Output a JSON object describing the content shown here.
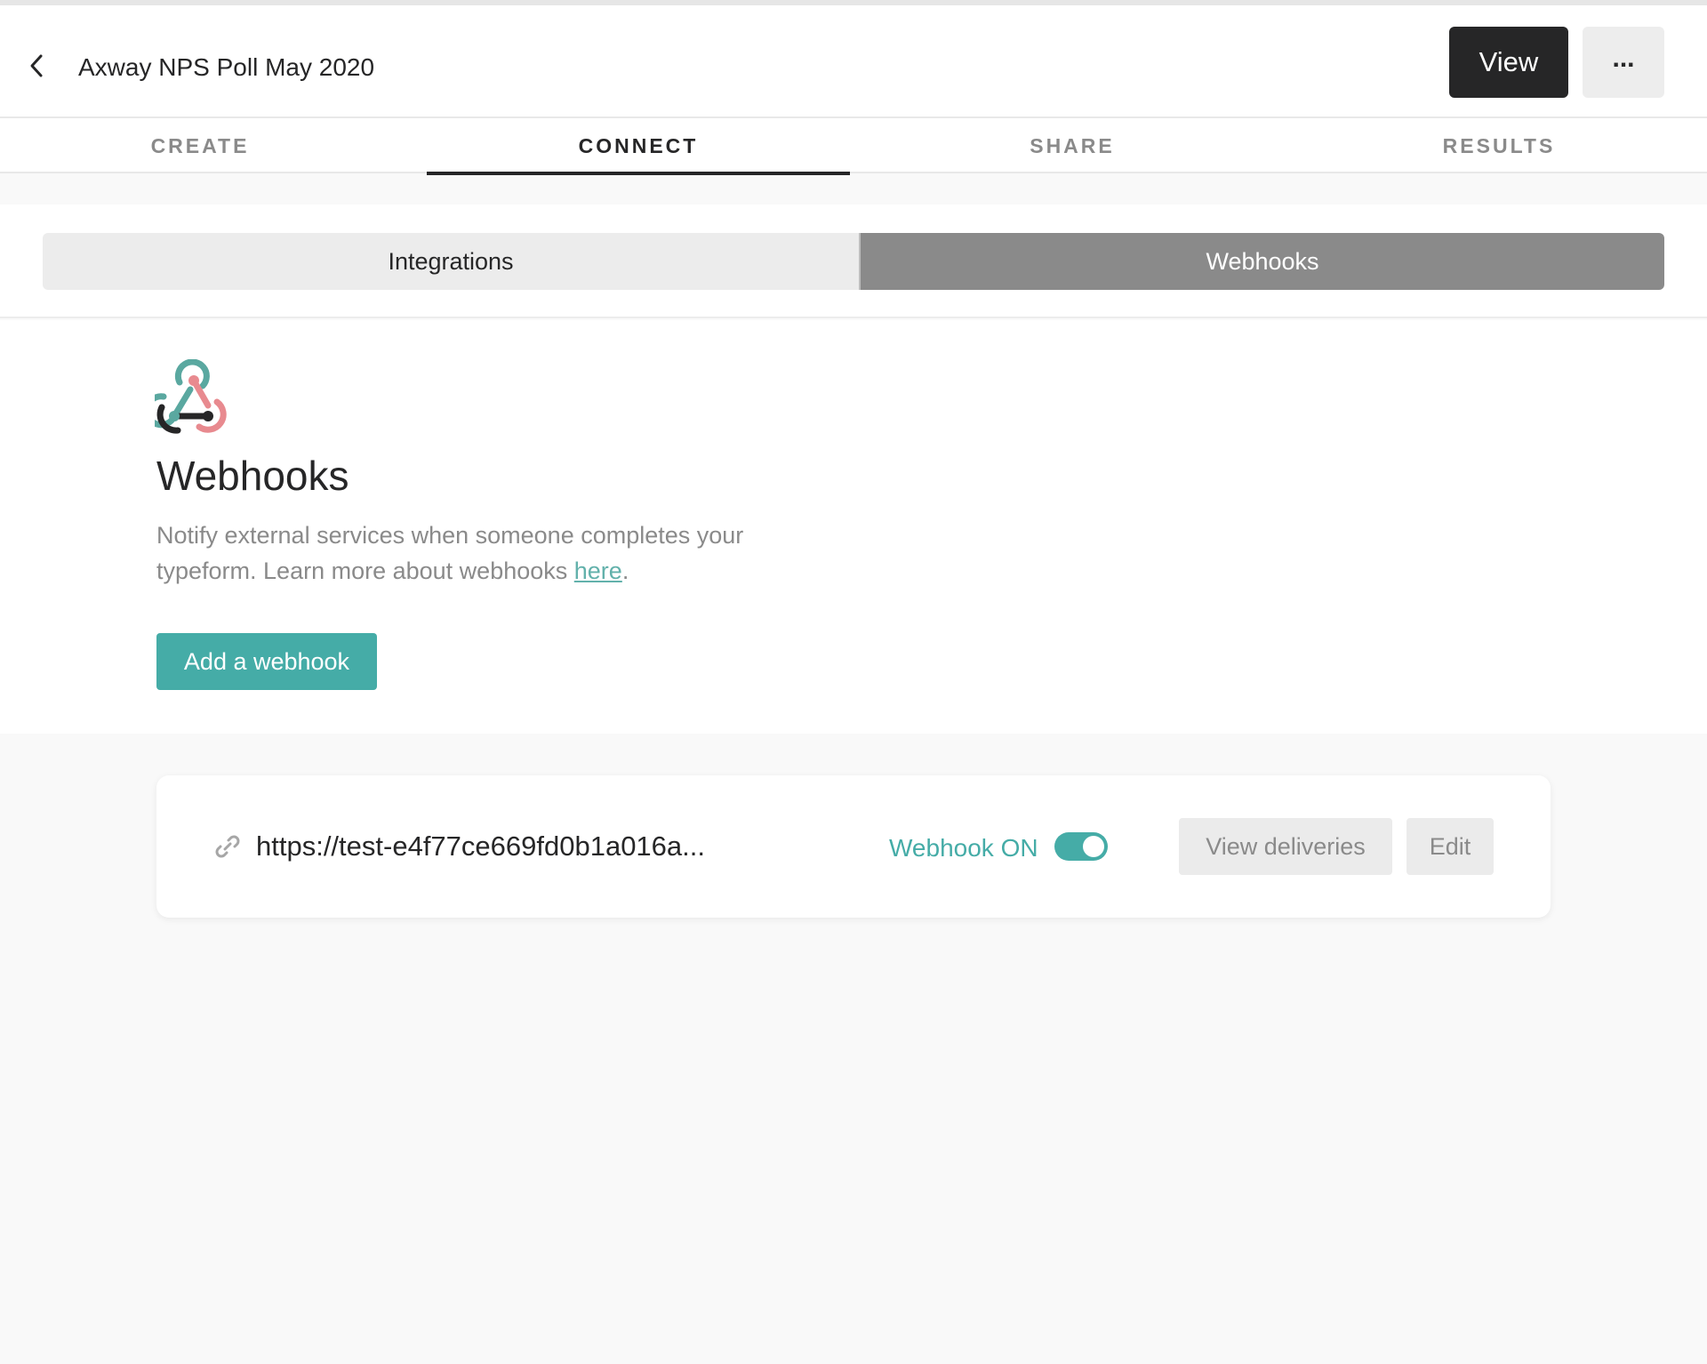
{
  "header": {
    "title": "Axway NPS Poll May 2020",
    "view_label": "View",
    "more_label": "..."
  },
  "tabs": [
    {
      "label": "CREATE",
      "active": false
    },
    {
      "label": "CONNECT",
      "active": true
    },
    {
      "label": "SHARE",
      "active": false
    },
    {
      "label": "RESULTS",
      "active": false
    }
  ],
  "subnav": {
    "integrations_label": "Integrations",
    "webhooks_label": "Webhooks",
    "selected": "Webhooks"
  },
  "intro": {
    "title": "Webhooks",
    "description": "Notify external services when someone completes your typeform. Learn more about webhooks ",
    "link_text": "here",
    "suffix": ".",
    "add_button_label": "Add a webhook"
  },
  "webhook": {
    "url": "https://test-e4f77ce669fd0b1a016a...",
    "status_label": "Webhook ON",
    "enabled": true,
    "view_deliveries_label": "View deliveries",
    "edit_label": "Edit"
  },
  "icons": {
    "back": "chevron-left-icon",
    "logo": "webhooks-logo-icon",
    "link": "link-icon"
  },
  "colors": {
    "accent": "#45aca7",
    "dark": "#262627",
    "muted": "#8a8a8a",
    "logo_teal": "#5aa8a0",
    "logo_pink": "#e88a8f"
  }
}
